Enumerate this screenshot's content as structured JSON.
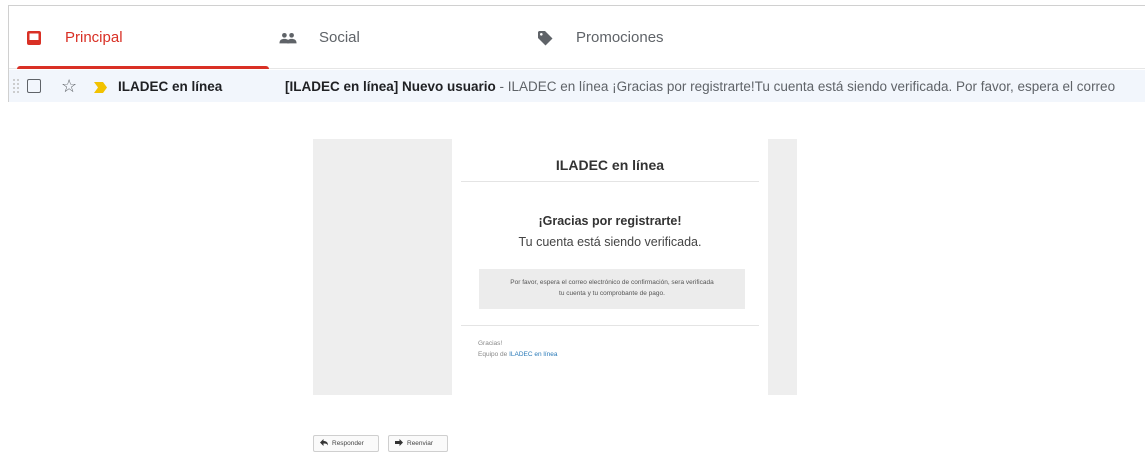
{
  "tabs": [
    {
      "label": "Principal",
      "icon": "inbox-icon",
      "active": true
    },
    {
      "label": "Social",
      "icon": "people-icon",
      "active": false
    },
    {
      "label": "Promociones",
      "icon": "tag-icon",
      "active": false
    }
  ],
  "message_row": {
    "sender": "ILADEC en línea",
    "subject": "[ILADEC en línea] Nuevo usuario",
    "snippet": " - ILADEC en línea ¡Gracias por registrarte!Tu cuenta está siendo verificada. Por favor, espera el correo",
    "starred": false,
    "important": true
  },
  "email": {
    "title": "ILADEC en línea",
    "thanks": "¡Gracias por registrarte!",
    "verification": "Tu cuenta está siendo verificada.",
    "notice_line1": "Por favor, espera el correo electrónico de confirmación, sera verificada",
    "notice_line2": "tu cuenta y tu comprobante de pago.",
    "signoff": "Gracias!",
    "team_prefix": "Equipo de ",
    "team_link": "ILADEC en línea"
  },
  "actions": {
    "reply": "Responder",
    "forward": "Reenviar"
  },
  "colors": {
    "accent": "#d93025",
    "important_marker": "#f2c200",
    "link": "#2a7ab8",
    "email_bg": "#eeeeee"
  }
}
